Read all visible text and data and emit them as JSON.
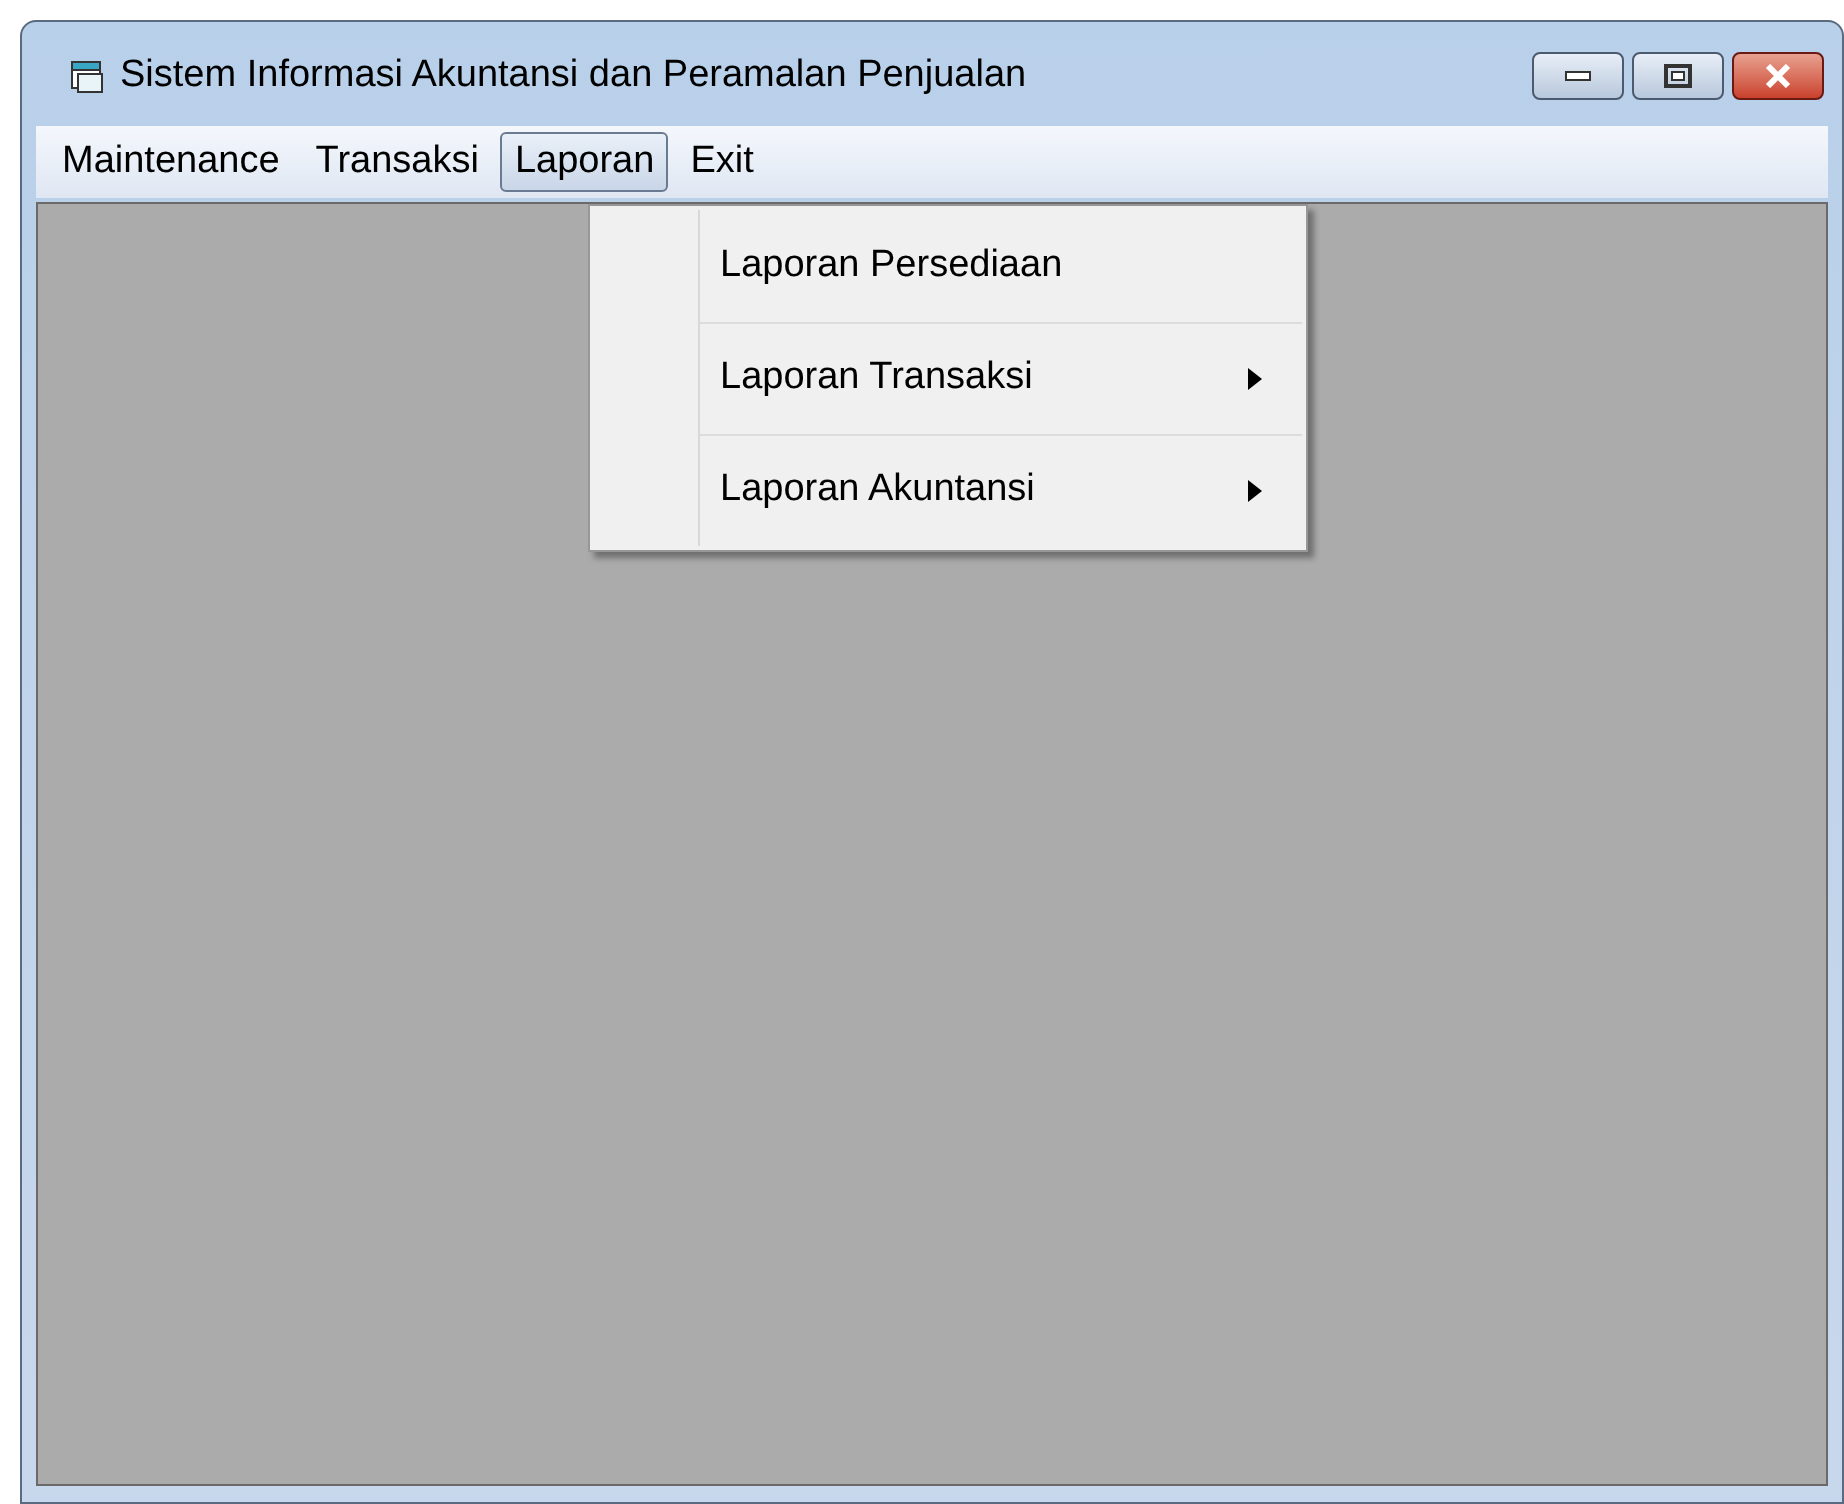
{
  "window": {
    "title": "Sistem Informasi Akuntansi dan Peramalan Penjualan"
  },
  "menu_bar": [
    {
      "label": "Maintenance",
      "selected": false
    },
    {
      "label": "Transaksi",
      "selected": false
    },
    {
      "label": "Laporan",
      "selected": true
    },
    {
      "label": "Exit",
      "selected": false
    }
  ],
  "dropdown": [
    {
      "label": "Laporan Persediaan",
      "has_submenu": false
    },
    {
      "label": "Laporan Transaksi",
      "has_submenu": true
    },
    {
      "label": "Laporan Akuntansi",
      "has_submenu": true
    }
  ]
}
